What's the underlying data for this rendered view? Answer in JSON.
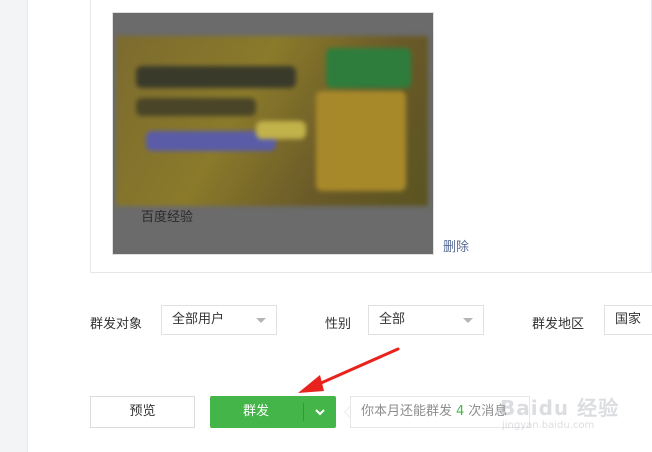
{
  "article": {
    "title": "百度经验",
    "delete_label": "删除"
  },
  "audience": {
    "target_label": "群发对象",
    "target_value": "全部用户",
    "gender_label": "性别",
    "gender_value": "全部",
    "region_label": "群发地区",
    "region_value": "国家"
  },
  "actions": {
    "preview_label": "预览",
    "send_label": "群发",
    "tip_prefix": "你本月还能群发",
    "tip_count": "4",
    "tip_suffix": "次消息"
  },
  "watermark": {
    "brand": "Baidu 经验",
    "domain": "jingyan.baidu.com"
  },
  "colors": {
    "primary_green": "#44b549",
    "link_blue": "#576b95",
    "annotation_red": "#e8231d"
  },
  "icons": {
    "dropdown": "caret-down-icon",
    "send_toggle": "chevron-down-icon",
    "annotation": "red-arrow-icon"
  }
}
